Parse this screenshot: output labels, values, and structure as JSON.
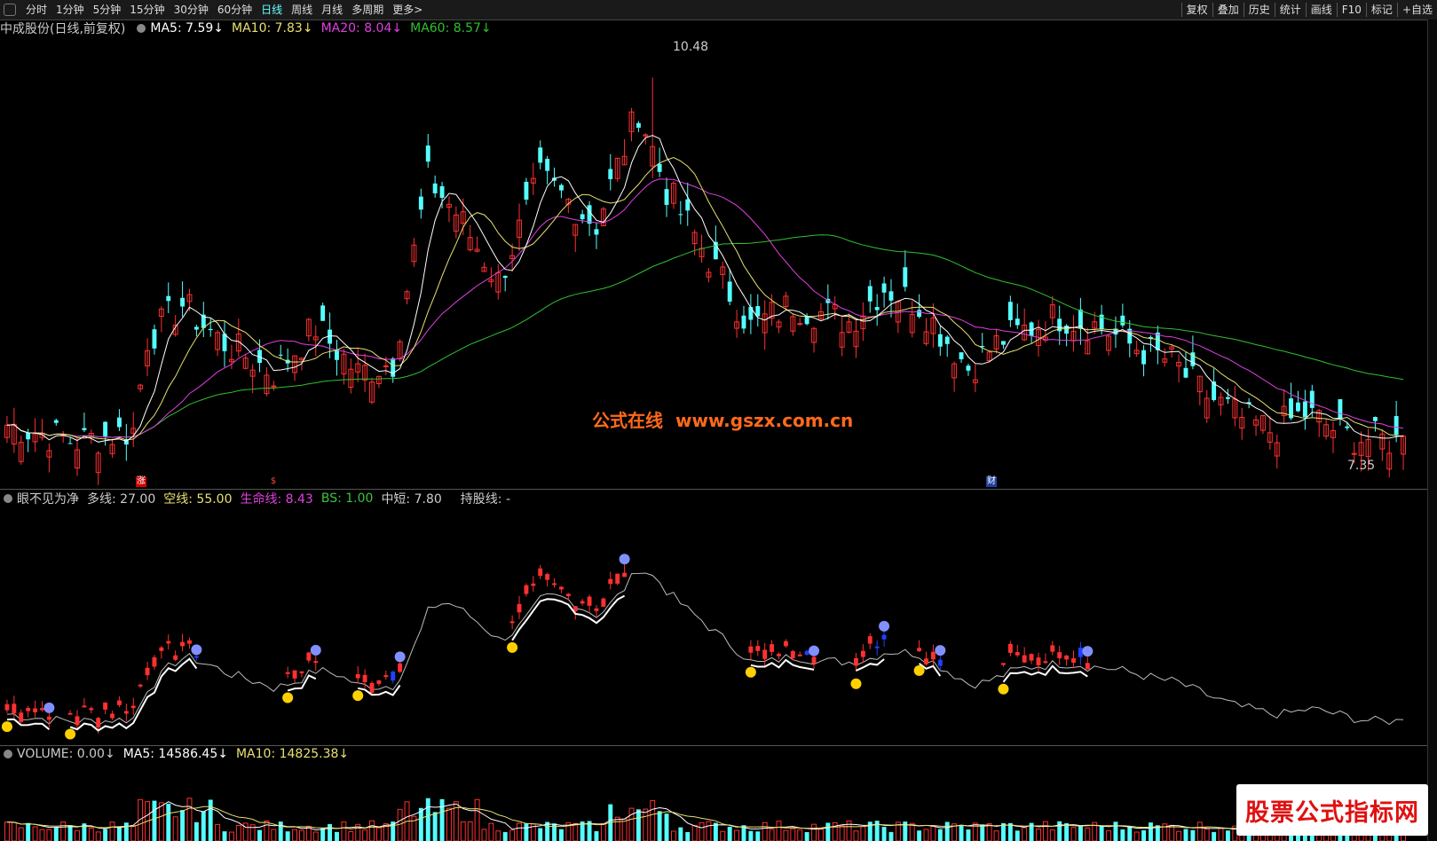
{
  "toolbar": {
    "left_items": [
      "分时",
      "1分钟",
      "5分钟",
      "15分钟",
      "30分钟",
      "60分钟",
      "日线",
      "周线",
      "月线",
      "多周期",
      "更多>"
    ],
    "active": "日线",
    "right_items": [
      "复权",
      "叠加",
      "历史",
      "统计",
      "画线",
      "F10",
      "标记",
      "+自选"
    ]
  },
  "main_legend": {
    "title": "中成股份(日线,前复权)",
    "ma5": "MA5: 7.59",
    "ma10": "MA10: 7.83",
    "ma20": "MA20: 8.04",
    "ma60": "MA60: 8.57",
    "arrow": "↓"
  },
  "indicator_legend": {
    "name": "眼不见为净",
    "duo": "多线: 27.00",
    "kong": "空线: 55.00",
    "life": "生命线: 8.43",
    "bs": "BS: 1.00",
    "mid": "中短: 7.80",
    "hold": "持股线: -"
  },
  "volume_legend": {
    "vol": "VOLUME: 0.00",
    "ma5": "MA5: 14586.45",
    "ma10": "MA10: 14825.38",
    "arrow": "↓"
  },
  "high_label": "10.48",
  "low_label": "7.35",
  "watermark": {
    "cn": "公式在线",
    "url": "www.gszx.com.cn"
  },
  "brand": "股票公式指标网",
  "markers": [
    "涨",
    "$",
    "财"
  ],
  "colors": {
    "up": "#ff3030",
    "down": "#55ffff",
    "ma5": "#ffffff",
    "ma10": "#e8e070",
    "ma20": "#e040e0",
    "ma60": "#30c030",
    "life": "#e040e0",
    "bs": "#40c040",
    "kong": "#e8e070"
  },
  "chart_data": {
    "type": "candlestick",
    "title": "中成股份(日线,前复权)",
    "count": 200,
    "close_anchors": [
      [
        0,
        7.45
      ],
      [
        10,
        7.3
      ],
      [
        18,
        7.4
      ],
      [
        20,
        8.2
      ],
      [
        25,
        8.5
      ],
      [
        30,
        8.2
      ],
      [
        38,
        7.9
      ],
      [
        44,
        8.3
      ],
      [
        50,
        7.9
      ],
      [
        55,
        8.0
      ],
      [
        60,
        9.6
      ],
      [
        64,
        9.3
      ],
      [
        70,
        8.7
      ],
      [
        76,
        9.6
      ],
      [
        84,
        9.2
      ],
      [
        90,
        10.2
      ],
      [
        94,
        9.5
      ],
      [
        100,
        8.9
      ],
      [
        106,
        8.3
      ],
      [
        112,
        8.5
      ],
      [
        120,
        8.35
      ],
      [
        125,
        8.65
      ],
      [
        130,
        8.5
      ],
      [
        137,
        7.95
      ],
      [
        142,
        8.2
      ],
      [
        150,
        8.4
      ],
      [
        156,
        8.3
      ],
      [
        160,
        8.15
      ],
      [
        166,
        8.0
      ],
      [
        170,
        7.75
      ],
      [
        176,
        7.5
      ],
      [
        180,
        7.4
      ],
      [
        185,
        7.55
      ],
      [
        191,
        7.35
      ],
      [
        199,
        7.3
      ]
    ],
    "ylim": [
      7.0,
      10.8
    ],
    "high": 10.48,
    "low": 7.35,
    "hold_signals": [
      [
        0,
        6,
        "buy"
      ],
      [
        9,
        27,
        "buy"
      ],
      [
        40,
        44,
        "buy"
      ],
      [
        50,
        56,
        "buy"
      ],
      [
        72,
        88,
        "buy"
      ],
      [
        106,
        115,
        "buy"
      ],
      [
        121,
        125,
        "buy"
      ],
      [
        130,
        133,
        "buy"
      ],
      [
        142,
        154,
        "buy"
      ]
    ],
    "volume_ylim": [
      0,
      60000
    ]
  }
}
